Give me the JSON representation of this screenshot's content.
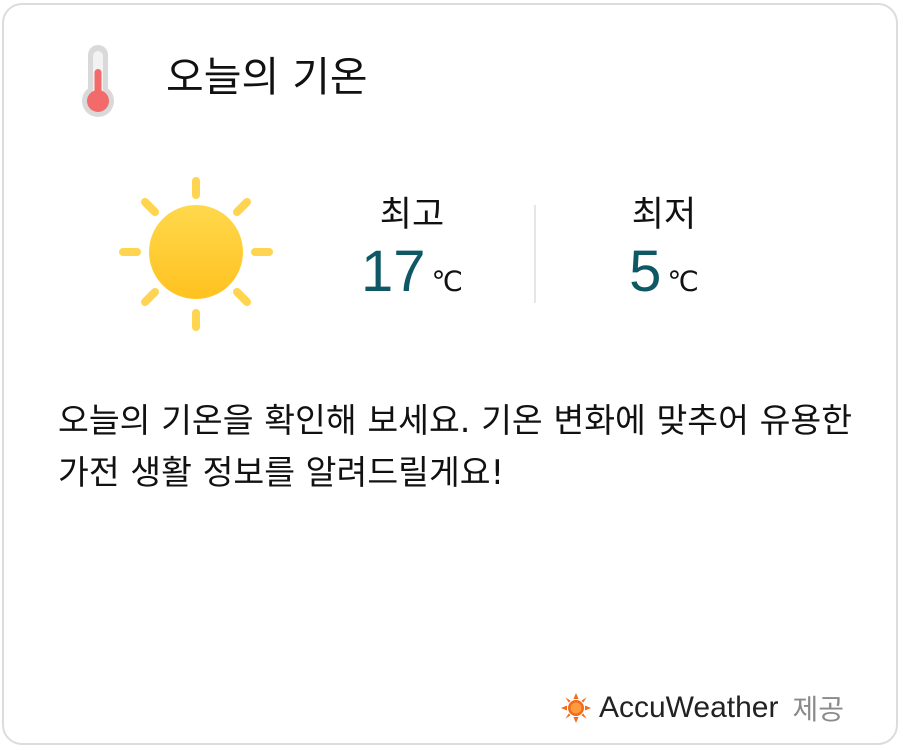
{
  "header": {
    "icon": "thermometer-icon",
    "title": "오늘의 기온"
  },
  "weather": {
    "condition_icon": "sun-icon",
    "high": {
      "label": "최고",
      "value": "17",
      "unit": "℃"
    },
    "low": {
      "label": "최저",
      "value": "5",
      "unit": "℃"
    },
    "value_color": "#0e5866"
  },
  "description": "오늘의 기온을 확인해 보세요. 기온 변화에 맞추어 유용한 가전 생활 정보를 알려드릴게요!",
  "footer": {
    "provider_icon": "accuweather-sun-icon",
    "provider_name": "AccuWeather",
    "provider_suffix": "제공",
    "provider_color": "#f26a1b"
  }
}
